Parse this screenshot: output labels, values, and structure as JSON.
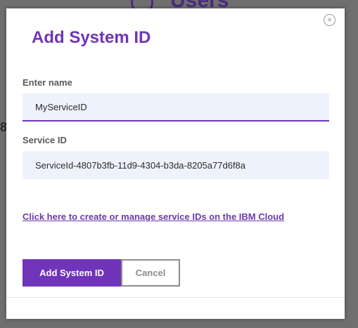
{
  "background": {
    "page_title": "Users",
    "partial_digit": "8"
  },
  "modal": {
    "title": "Add System ID",
    "close_glyph": "×",
    "name_field": {
      "label": "Enter name",
      "value": "MyServiceID"
    },
    "service_field": {
      "label": "Service ID",
      "value": "ServiceId-4807b3fb-11d9-4304-b3da-8205a77d6f8a"
    },
    "link_text": "Click here to create or manage service IDs on the IBM Cloud",
    "buttons": {
      "primary_label": "Add System ID",
      "secondary_label": "Cancel"
    }
  },
  "colors": {
    "accent": "#7034b8",
    "input_background": "#edf2fc",
    "overlay": "#6f6f6f"
  }
}
